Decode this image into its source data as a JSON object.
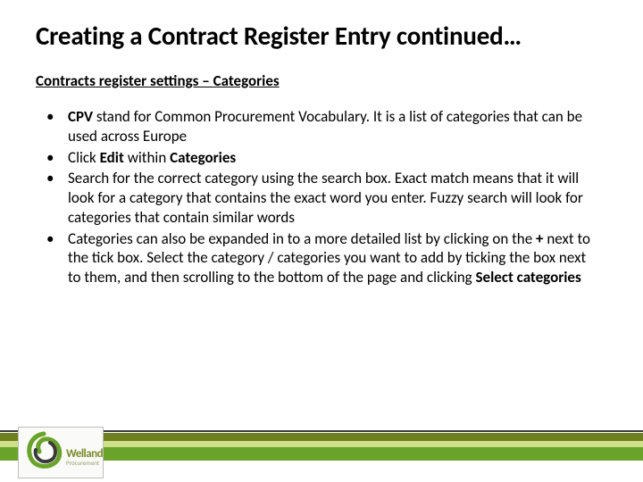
{
  "title": "Creating a Contract Register Entry continued…",
  "subtitle": "Contracts register settings – Categories",
  "bullets": [
    {
      "pre": "",
      "b1": "CPV",
      "mid1": " stand for Common Procurement Vocabulary. It is a list of categories that can be used across Europe",
      "b2": "",
      "mid2": "",
      "b3": "",
      "tail": ""
    },
    {
      "pre": "Click ",
      "b1": "Edit",
      "mid1": " within ",
      "b2": "Categories",
      "mid2": "",
      "b3": "",
      "tail": ""
    },
    {
      "pre": "Search for the correct category using the search box. Exact match means that it will look for a category that contains the exact word you enter. Fuzzy search will look for categories that contain similar words",
      "b1": "",
      "mid1": "",
      "b2": "",
      "mid2": "",
      "b3": "",
      "tail": ""
    },
    {
      "pre": "Categories can also be expanded in to a more detailed list by clicking on the ",
      "b1": "+",
      "mid1": " next to the tick box. Select the category / categories you want to add by ticking the box next to them, and then scrolling to the bottom of the page and clicking ",
      "b2": "Select categories",
      "mid2": "",
      "b3": "",
      "tail": ""
    }
  ],
  "logo": {
    "brand_top": "Welland",
    "brand_bottom": "Procurement"
  }
}
